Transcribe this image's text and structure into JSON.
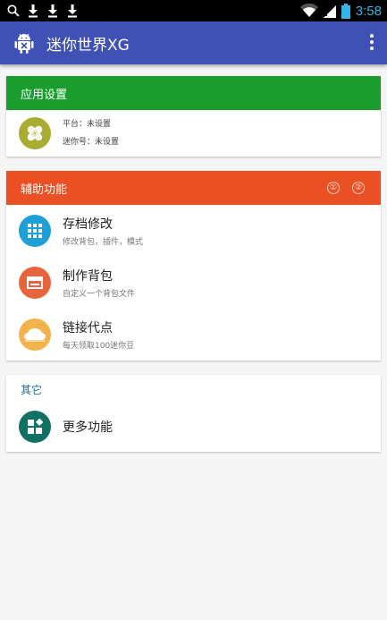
{
  "status_bar": {
    "time": "3:58",
    "icons": [
      "search-icon",
      "download-icon",
      "download-icon",
      "download-icon",
      "wifi-icon",
      "signal-icon",
      "battery-icon"
    ]
  },
  "app_bar": {
    "title": "迷你世界XG",
    "logo": "android-icon",
    "menu": "overflow-menu-icon",
    "color": "#3f51b5"
  },
  "app_settings": {
    "header": "应用设置",
    "color": "#1a9d2f",
    "platform_label": "平台：未设置",
    "mini_id_label": "迷你号：未设置",
    "icon": "bandage-icon"
  },
  "assist": {
    "header": "辅助功能",
    "color": "#eb5024",
    "badge_1": "①",
    "badge_2": "②",
    "items": [
      {
        "title": "存档修改",
        "subtitle": "修改背包，插件，模式",
        "icon": "grid-icon",
        "color": "#1e9fd6"
      },
      {
        "title": "制作背包",
        "subtitle": "自定义一个背包文件",
        "icon": "window-icon",
        "color": "#e8643c"
      },
      {
        "title": "链接代点",
        "subtitle": "每天领取100迷你豆",
        "icon": "cloud-icon",
        "color": "#f2b34a"
      }
    ]
  },
  "other": {
    "header": "其它",
    "items": [
      {
        "title": "更多功能",
        "icon": "widgets-icon",
        "color": "#117064"
      }
    ]
  }
}
